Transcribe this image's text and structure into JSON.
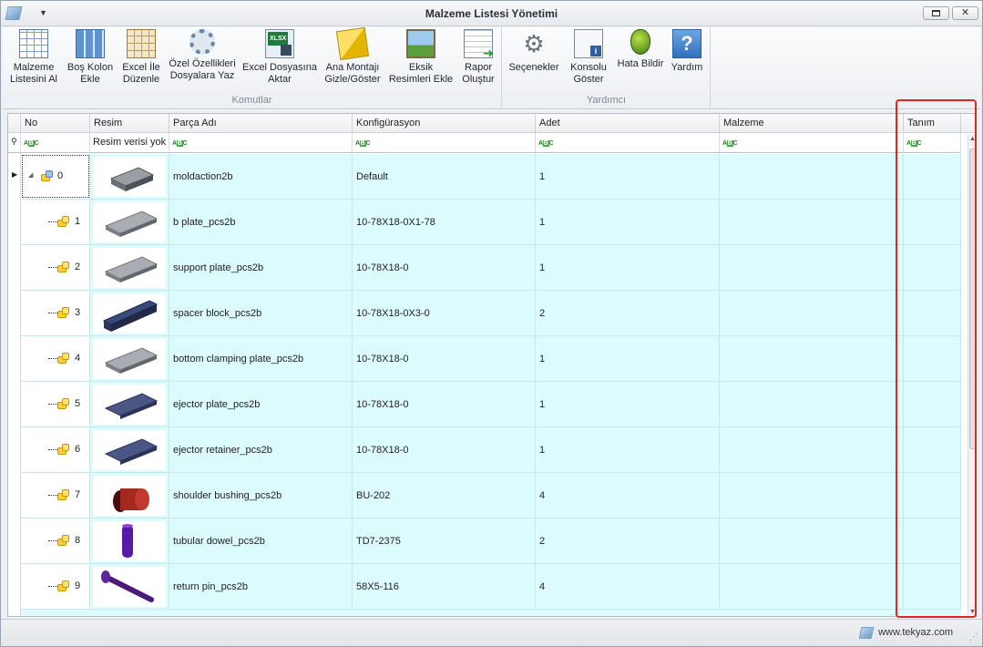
{
  "window": {
    "title": "Malzeme Listesi Yönetimi",
    "qa_menu": "▼",
    "close": "✕"
  },
  "ribbon": {
    "groups": [
      {
        "caption": "Komutlar"
      },
      {
        "caption": "Yardımcı"
      }
    ],
    "buttons": [
      {
        "label": "Malzeme\nListesini Al",
        "icon": "table-import-icon"
      },
      {
        "label": "Boş Kolon\nEkle",
        "icon": "columns-icon"
      },
      {
        "label": "Excel İle\nDüzenle",
        "icon": "excel-grid-icon"
      },
      {
        "label": "Özel Özellikleri\nDosyalara Yaz",
        "icon": "gear-document-icon"
      },
      {
        "label": "Excel Dosyasına\nAktar",
        "icon": "xlsx-export-icon"
      },
      {
        "label": "Ana Montajı\nGizle/Göster",
        "icon": "assembly-cubes-icon"
      },
      {
        "label": "Eksik\nResimleri Ekle",
        "icon": "add-picture-icon"
      },
      {
        "label": "Rapor\nOluştur",
        "icon": "report-icon"
      },
      {
        "label": "Seçenekler",
        "icon": "gears-icon"
      },
      {
        "label": "Konsolu\nGöster",
        "icon": "console-icon"
      },
      {
        "label": "Hata Bildir",
        "icon": "bug-icon"
      },
      {
        "label": "Yardım",
        "icon": "help-icon"
      }
    ]
  },
  "grid": {
    "columns": [
      "No",
      "Resim",
      "Parça Adı",
      "Konfigürasyon",
      "Adet",
      "Malzeme",
      "Tanım"
    ],
    "filter": {
      "resim_text": "Resim verisi yok",
      "abc_a": "A",
      "abc_b": "B",
      "abc_c": "C"
    },
    "rows": [
      {
        "no": "0",
        "name": "moldaction2b",
        "config": "Default",
        "qty": "1",
        "thumb": "plate-stack"
      },
      {
        "no": "1",
        "name": "b plate_pcs2b",
        "config": "10-78X18-0X1-78",
        "qty": "1",
        "thumb": "plate-gray"
      },
      {
        "no": "2",
        "name": "support plate_pcs2b",
        "config": "10-78X18-0",
        "qty": "1",
        "thumb": "plate-gray"
      },
      {
        "no": "3",
        "name": "spacer block_pcs2b",
        "config": "10-78X18-0X3-0",
        "qty": "2",
        "thumb": "bar-navy"
      },
      {
        "no": "4",
        "name": "bottom clamping plate_pcs2b",
        "config": "10-78X18-0",
        "qty": "1",
        "thumb": "plate-gray"
      },
      {
        "no": "5",
        "name": "ejector plate_pcs2b",
        "config": "10-78X18-0",
        "qty": "1",
        "thumb": "plate-navy"
      },
      {
        "no": "6",
        "name": "ejector retainer_pcs2b",
        "config": "10-78X18-0",
        "qty": "1",
        "thumb": "plate-navy"
      },
      {
        "no": "7",
        "name": "shoulder bushing_pcs2b",
        "config": "BU-202",
        "qty": "4",
        "thumb": "bushing-red"
      },
      {
        "no": "8",
        "name": "tubular dowel_pcs2b",
        "config": "TD7-2375",
        "qty": "2",
        "thumb": "dowel-purple"
      },
      {
        "no": "9",
        "name": "return pin_pcs2b",
        "config": "58X5-116",
        "qty": "4",
        "thumb": "pin-purple"
      }
    ]
  },
  "status": {
    "site": "www.tekyaz.com"
  }
}
